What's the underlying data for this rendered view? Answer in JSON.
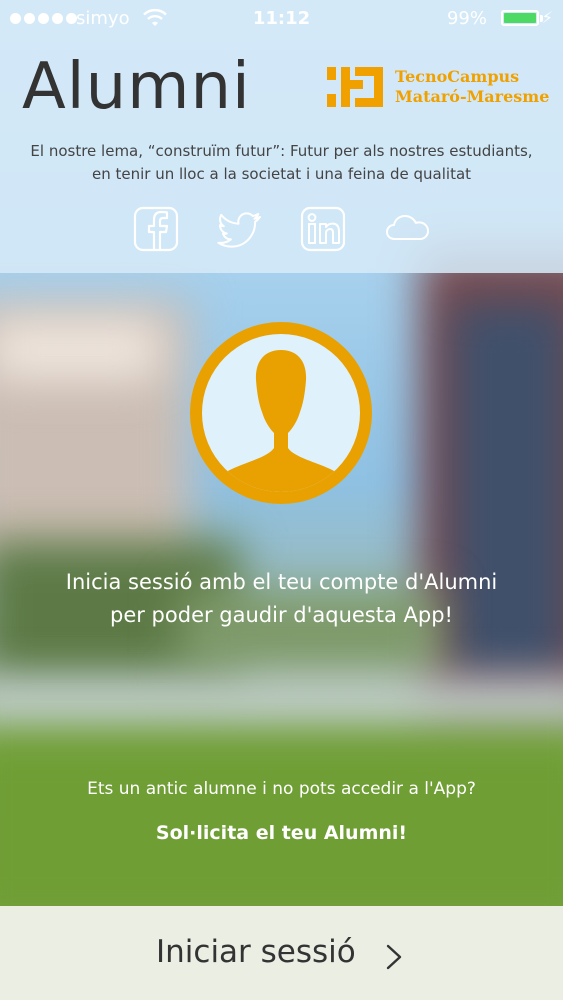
{
  "status_bar": {
    "carrier": "simyo",
    "time": "11:12",
    "battery_percent": "99%",
    "battery_level": 0.99
  },
  "header": {
    "title": "Alumni",
    "logo": {
      "line1": "TecnoCampus",
      "line2": "Mataró-Maresme"
    },
    "motto_line1": "El nostre lema, “construïm futur”: Futur per als nostres estudiants,",
    "motto_line2": "en tenir un lloc a la societat i una feina de qualitat"
  },
  "social": [
    {
      "icon": "facebook-icon"
    },
    {
      "icon": "twitter-icon"
    },
    {
      "icon": "linkedin-icon"
    },
    {
      "icon": "cloud-icon"
    }
  ],
  "main": {
    "message_line1": "Inicia sessió amb el teu compte d'Alumni",
    "message_line2": "per poder gaudir d'aquesta App!",
    "question": "Ets un antic alumne i no pots accedir a l'App?",
    "request_link": "Sol·licita el teu Alumni!"
  },
  "login": {
    "label": "Iniciar sessió"
  },
  "colors": {
    "accent": "#e8a100",
    "panel": "#d6eaf8",
    "battery": "#4cd964"
  }
}
